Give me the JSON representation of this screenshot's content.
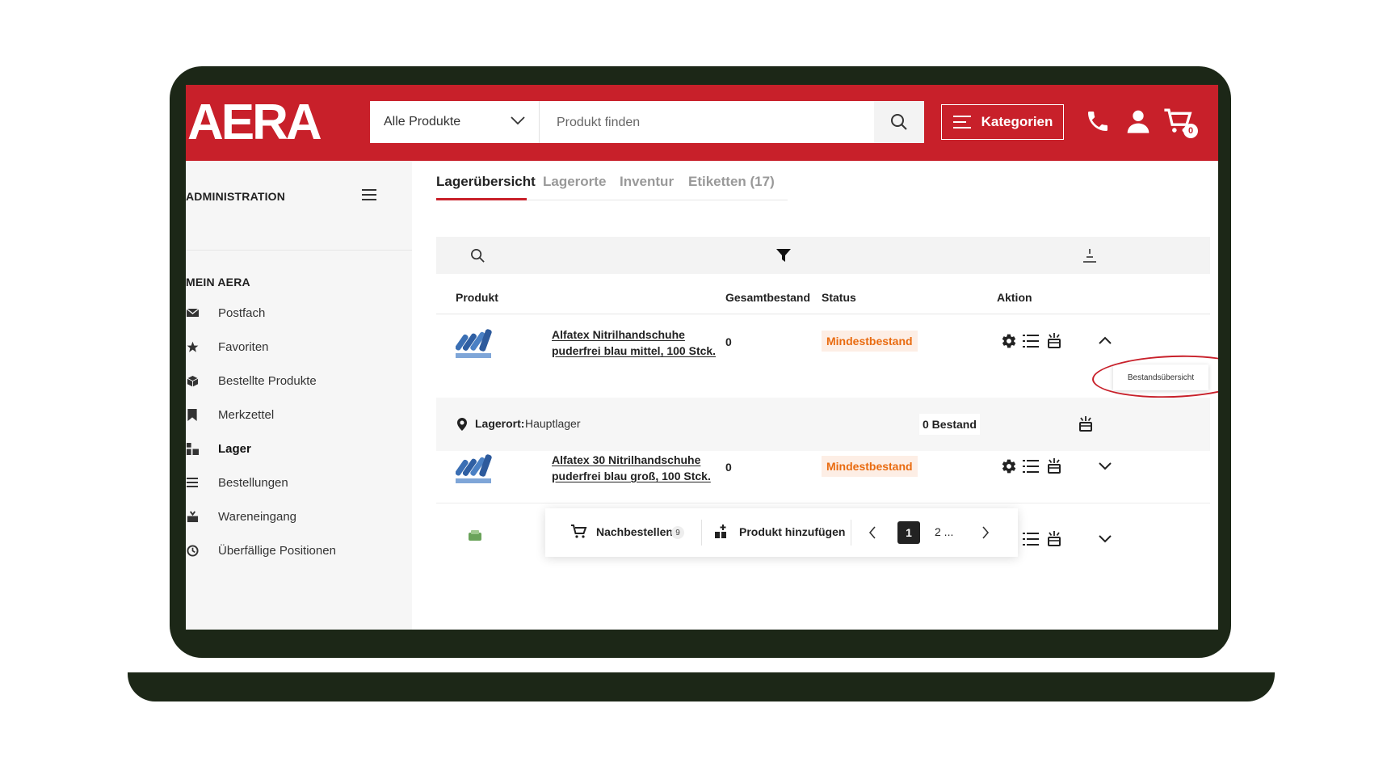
{
  "header": {
    "logo": "AERA",
    "category_select": "Alle Produkte",
    "search_placeholder": "Produkt finden",
    "kategorien_label": "Kategorien",
    "cart_count": "0"
  },
  "sidebar": {
    "admin_title": "ADMINISTRATION",
    "mein_title": "MEIN AERA",
    "items": [
      {
        "label": "Postfach",
        "icon": "envelope-icon"
      },
      {
        "label": "Favoriten",
        "icon": "star-icon"
      },
      {
        "label": "Bestellte Produkte",
        "icon": "box-icon"
      },
      {
        "label": "Merkzettel",
        "icon": "bookmark-icon"
      },
      {
        "label": "Lager",
        "icon": "warehouse-icon"
      },
      {
        "label": "Bestellungen",
        "icon": "list-icon"
      },
      {
        "label": "Wareneingang",
        "icon": "incoming-goods-icon"
      },
      {
        "label": "Überfällige Positionen",
        "icon": "overdue-icon"
      }
    ]
  },
  "tabs": [
    "Lagerübersicht",
    "Lagerorte",
    "Inventur",
    "Etiketten (17)"
  ],
  "table": {
    "headers": {
      "product": "Produkt",
      "total": "Gesamtbestand",
      "status": "Status",
      "action": "Aktion"
    },
    "rows": [
      {
        "name_line1": "Alfatex Nitrilhandschuhe",
        "name_line2": "puderfrei blau mittel, 100 Stck.",
        "total": "0",
        "status": "Mindestbestand"
      },
      {
        "name_line1": "Alfatex 30 Nitrilhandschuhe",
        "name_line2": "puderfrei blau groß, 100 Stck.",
        "total": "0",
        "status": "Mindestbestand"
      }
    ],
    "lagerort": {
      "label": "Lagerort:",
      "value": "Hauptlager",
      "stock": "0 Bestand"
    },
    "tooltip": "Bestandsübersicht"
  },
  "bottom_bar": {
    "reorder_label": "Nachbestellen",
    "reorder_count": "9",
    "add_label": "Produkt hinzufügen",
    "page_current": "1",
    "page_more": "2 ..."
  },
  "colors": {
    "brand_red": "#c8202a",
    "status_orange": "#e96b10",
    "laptop_frame": "#1c2717"
  }
}
